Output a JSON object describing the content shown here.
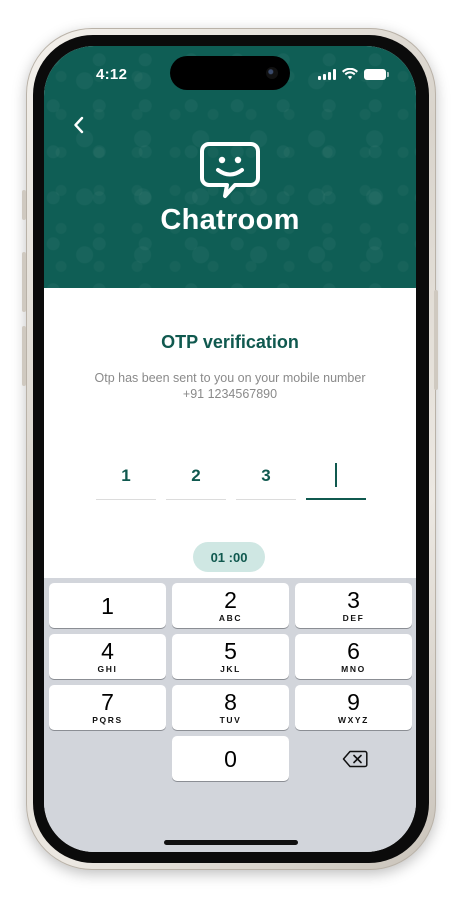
{
  "status_bar": {
    "time": "4:12",
    "icons": [
      "signal-icon",
      "wifi-icon",
      "battery-icon"
    ]
  },
  "header": {
    "app_title": "Chatroom",
    "logo_icon": "chat-smile-icon",
    "back_icon": "chevron-left-icon",
    "color": "#0f5e55"
  },
  "otp": {
    "title": "OTP verification",
    "subtitle": "Otp has been sent to you on your mobile number +91 1234567890",
    "digits": [
      "1",
      "2",
      "3",
      ""
    ],
    "active_index": 3,
    "timer": "01 :00"
  },
  "keypad": {
    "keys": [
      {
        "num": "1",
        "letters": ""
      },
      {
        "num": "2",
        "letters": "ABC"
      },
      {
        "num": "3",
        "letters": "DEF"
      },
      {
        "num": "4",
        "letters": "GHI"
      },
      {
        "num": "5",
        "letters": "JKL"
      },
      {
        "num": "6",
        "letters": "MNO"
      },
      {
        "num": "7",
        "letters": "PQRS"
      },
      {
        "num": "8",
        "letters": "TUV"
      },
      {
        "num": "9",
        "letters": "WXYZ"
      },
      {
        "num": "0",
        "letters": ""
      }
    ],
    "delete_icon": "backspace-icon"
  },
  "colors": {
    "accent": "#10594f",
    "timer_bg": "#cfe7e3",
    "keypad_bg": "#d2d5db"
  }
}
